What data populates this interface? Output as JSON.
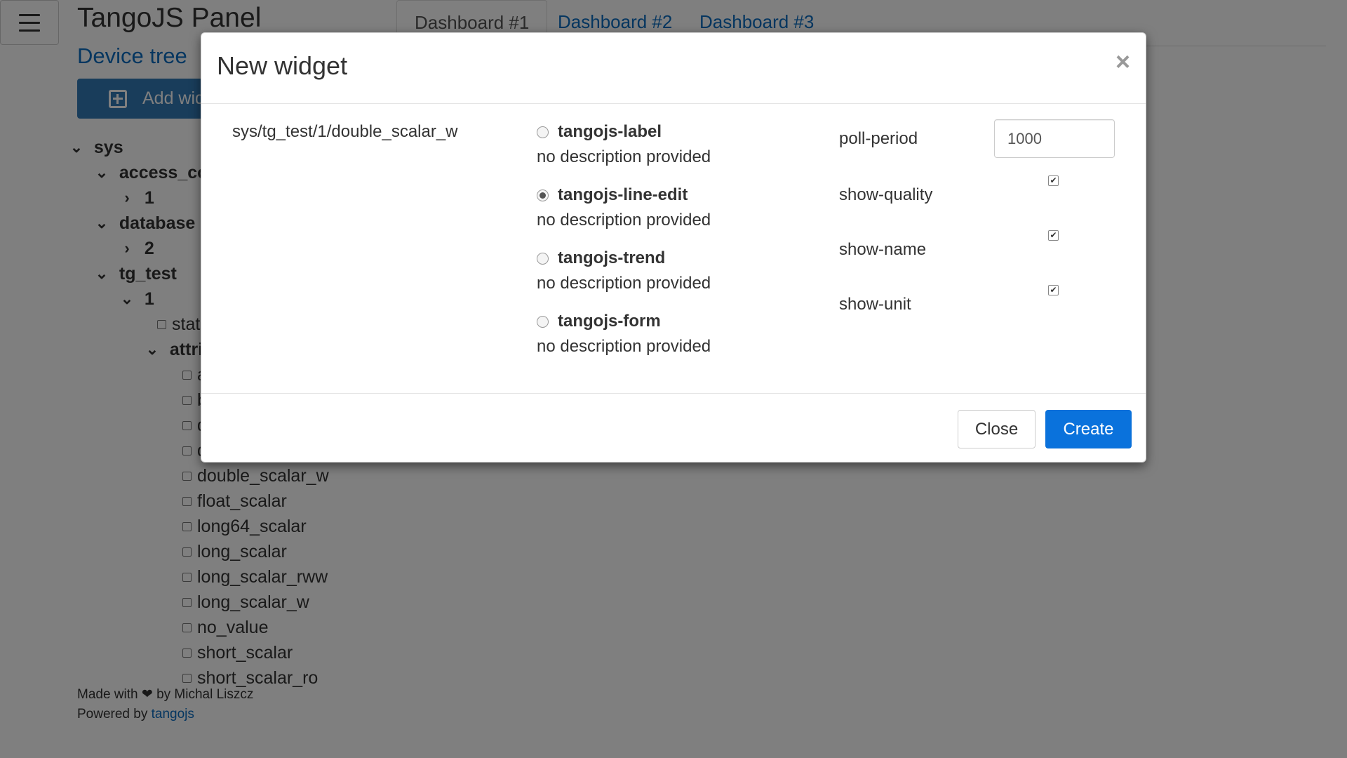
{
  "header": {
    "title": "TangoJS Panel",
    "menu_icon": "hamburger-icon",
    "tabs": [
      {
        "label": "Dashboard #1",
        "active": true
      },
      {
        "label": "Dashboard #2",
        "active": false
      },
      {
        "label": "Dashboard #3",
        "active": false
      }
    ]
  },
  "sidebar": {
    "device_tree_link": "Device tree",
    "add_button_label": "Add widget",
    "tree": [
      {
        "label": "sys",
        "kind": "folder"
      },
      {
        "label": "access_control",
        "kind": "folder"
      },
      {
        "label": "1",
        "kind": "folder-collapsed"
      },
      {
        "label": "database",
        "kind": "folder"
      },
      {
        "label": "2",
        "kind": "folder-collapsed"
      },
      {
        "label": "tg_test",
        "kind": "folder"
      },
      {
        "label": "1",
        "kind": "folder"
      },
      {
        "label": "state",
        "kind": "leaf"
      },
      {
        "label": "attributes",
        "kind": "folder"
      },
      {
        "label": "ampli",
        "kind": "leaf"
      },
      {
        "label": "boolean_scalar",
        "kind": "leaf"
      },
      {
        "label": "double_scalar",
        "kind": "leaf"
      },
      {
        "label": "double_scalar_rww",
        "kind": "leaf"
      },
      {
        "label": "double_scalar_w",
        "kind": "leaf"
      },
      {
        "label": "float_scalar",
        "kind": "leaf"
      },
      {
        "label": "long64_scalar",
        "kind": "leaf"
      },
      {
        "label": "long_scalar",
        "kind": "leaf"
      },
      {
        "label": "long_scalar_rww",
        "kind": "leaf"
      },
      {
        "label": "long_scalar_w",
        "kind": "leaf"
      },
      {
        "label": "no_value",
        "kind": "leaf"
      },
      {
        "label": "short_scalar",
        "kind": "leaf"
      },
      {
        "label": "short_scalar_ro",
        "kind": "leaf"
      }
    ]
  },
  "footer": {
    "made_with": "Made with ❤ by Michal Liszcz",
    "powered_by": "Powered by ",
    "powered_link": "tangojs"
  },
  "modal": {
    "title": "New widget",
    "close_glyph": "×",
    "attribute": "sys/tg_test/1/double_scalar_w",
    "widgets": [
      {
        "name": "tangojs-label",
        "description": "no description provided",
        "selected": false
      },
      {
        "name": "tangojs-line-edit",
        "description": "no description provided",
        "selected": true
      },
      {
        "name": "tangojs-trend",
        "description": "no description provided",
        "selected": false
      },
      {
        "name": "tangojs-form",
        "description": "no description provided",
        "selected": false
      }
    ],
    "params": {
      "poll_period_label": "poll-period",
      "poll_period_value": "1000",
      "show_quality_label": "show-quality",
      "show_quality_checked": true,
      "show_name_label": "show-name",
      "show_name_checked": true,
      "show_unit_label": "show-unit",
      "show_unit_checked": true
    },
    "buttons": {
      "close": "Close",
      "create": "Create"
    }
  }
}
